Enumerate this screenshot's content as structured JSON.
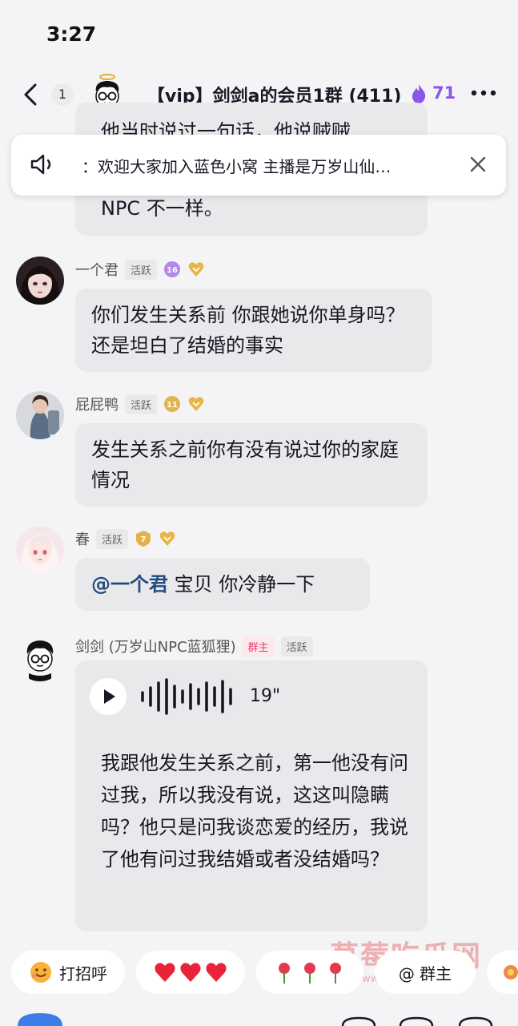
{
  "status_bar": {
    "time": "3:27"
  },
  "header": {
    "unread_count": "1",
    "title": "【vip】剑剑a的会员1群 (411)",
    "heat": "71"
  },
  "announcement": {
    "text": "：欢迎大家加入蓝色小窝 主播是万岁山仙…"
  },
  "top_bubble": {
    "partial_line": "他当时说过一句话，他说贼贼",
    "last_line": "NPC 不一样。"
  },
  "messages": [
    {
      "sender": "一个君",
      "tag": "活跃",
      "level": "16",
      "text": "你们发生关系前 你跟她说你单身吗？还是坦白了结婚的事实"
    },
    {
      "sender": "屁屁鸭",
      "tag": "活跃",
      "level": "11",
      "text": "发生关系之前你有没有说过你的家庭情况"
    },
    {
      "sender": "春",
      "tag": "活跃",
      "level": "7",
      "mention": "@一个君",
      "text": " 宝贝 你冷静一下"
    }
  ],
  "voice_message": {
    "sender": "剑剑 (万岁山NPC蓝狐狸)",
    "owner_tag": "群主",
    "tag": "活跃",
    "duration": "19\"",
    "transcript": "我跟他发生关系之前，第一他没有问过我，所以我没有说，这这叫隐瞒吗？他只是问我谈恋爱的经历，我说了他有问过我结婚或者没结婚吗？"
  },
  "quick_replies": [
    {
      "label": "打招呼",
      "icon": "smile-emoji-icon"
    },
    {
      "label": "",
      "icon": "three-hearts-icon"
    },
    {
      "label": "",
      "icon": "three-roses-icon"
    },
    {
      "label": "@ 群主",
      "icon": "at-icon"
    }
  ],
  "watermark": {
    "text": "草莓吃瓜网",
    "url": "www.cmcgw.com"
  },
  "colors": {
    "accent_purple": "#8a56e8",
    "owner_pink": "#e8416f",
    "mention_blue": "#234c7e"
  }
}
